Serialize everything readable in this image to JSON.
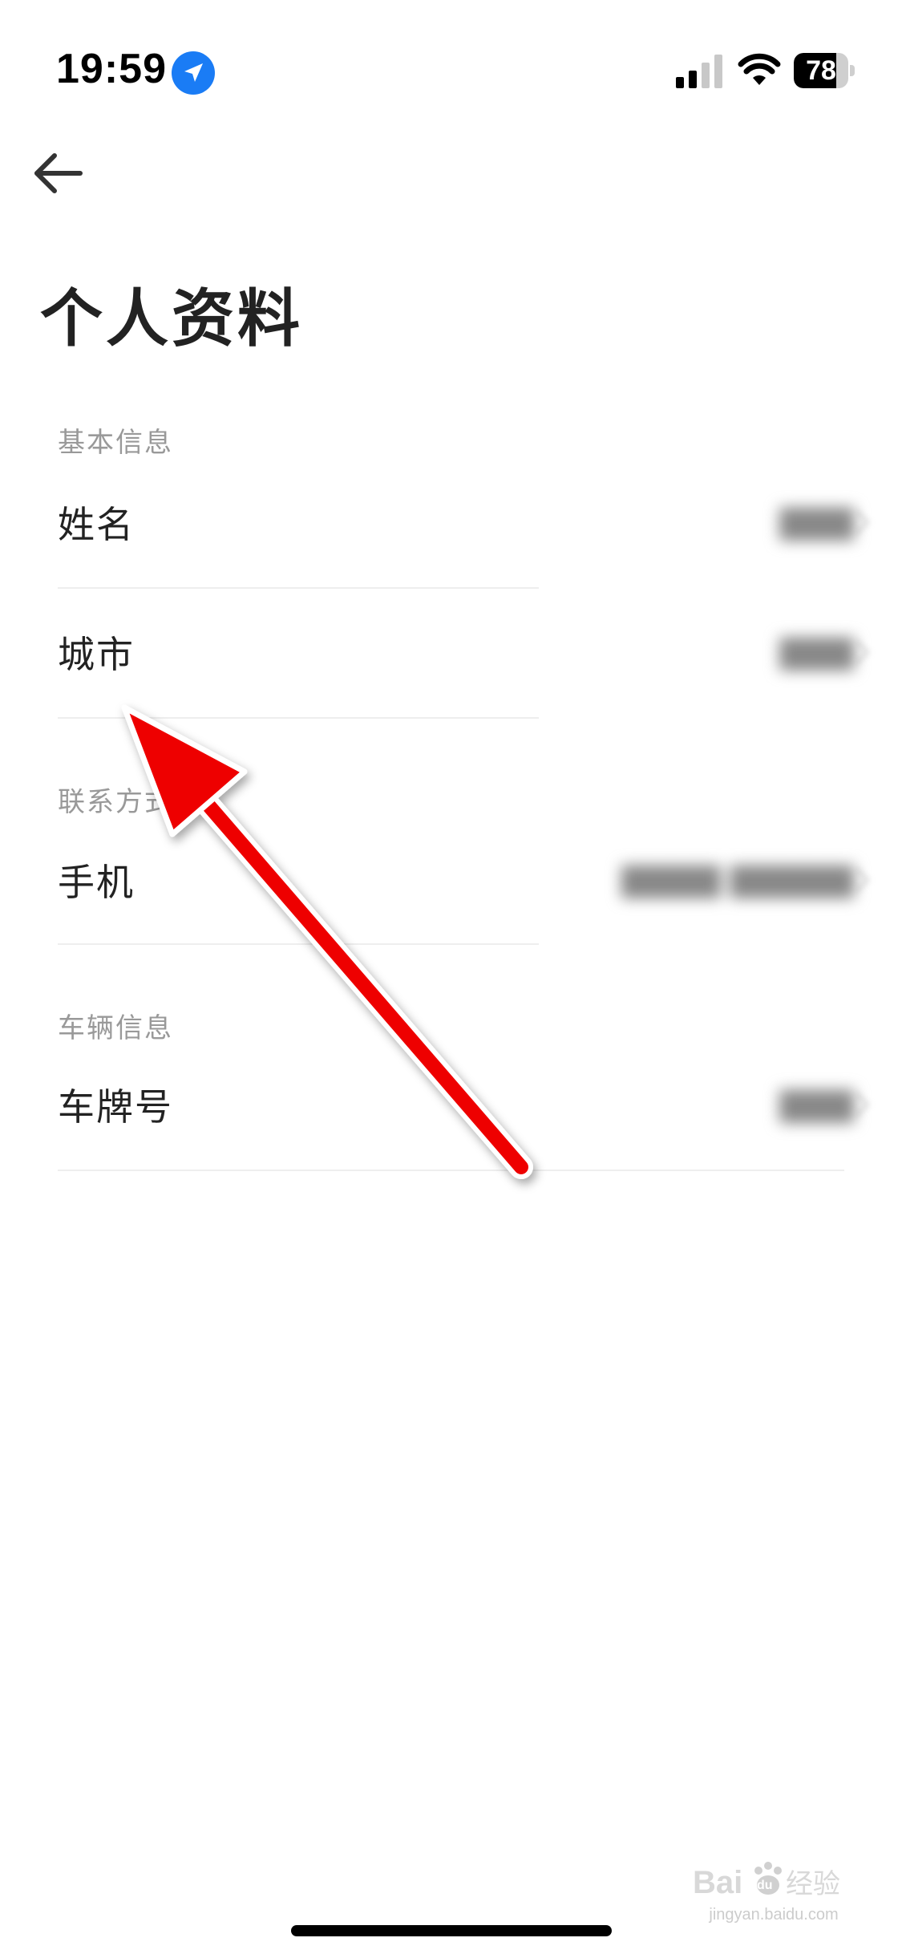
{
  "status_bar": {
    "time": "19:59",
    "battery_percent": "78",
    "battery_level": 0.78,
    "icons": [
      "location-arrow-icon",
      "cellular-signal-icon",
      "wifi-icon",
      "battery-icon"
    ],
    "location_color": "#1a7cf5"
  },
  "header": {
    "back_icon": "arrow-left-icon",
    "title": "个人资料"
  },
  "sections": [
    {
      "label": "基本信息",
      "rows": [
        {
          "label": "姓名"
        },
        {
          "label": "城市"
        }
      ]
    },
    {
      "label": "联系方式",
      "rows": [
        {
          "label": "手机"
        }
      ]
    },
    {
      "label": "车辆信息",
      "rows": [
        {
          "label": "车牌号"
        }
      ]
    }
  ],
  "annotation": {
    "type": "arrow",
    "color": "#ee0000"
  },
  "watermark": {
    "logo": "Baidu",
    "logo_suffix": "经验",
    "text": "jingyan.baidu.com"
  }
}
